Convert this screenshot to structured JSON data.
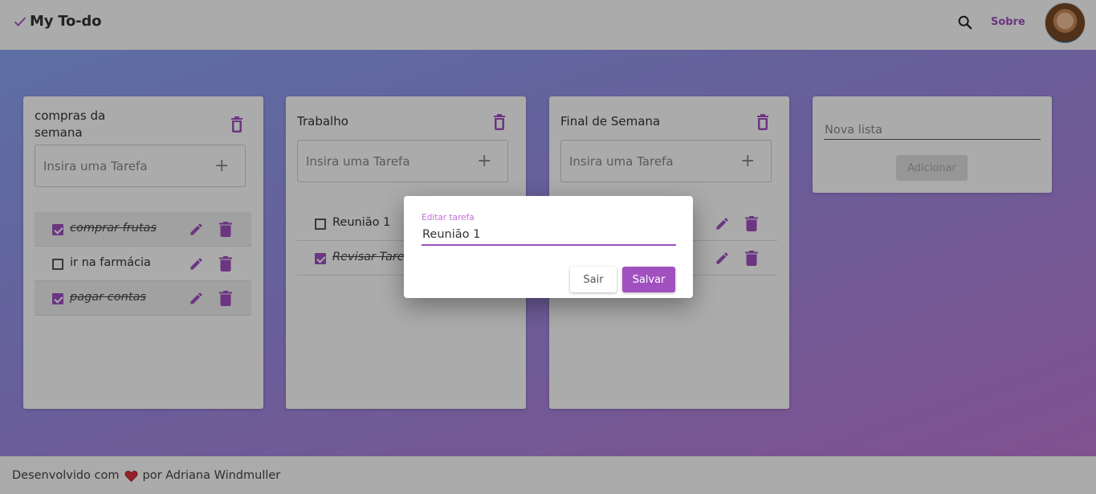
{
  "app": {
    "title": "My To-do"
  },
  "header": {
    "brand_icon": "check-icon",
    "search_icon": "search-icon",
    "about_label": "Sobre",
    "avatar": "user-avatar"
  },
  "colors": {
    "accent": "#a150c0",
    "accent_light": "#c070d8",
    "gradient_start": "#8aa6f5",
    "gradient_end": "#c07ad6"
  },
  "lists": [
    {
      "title": "compras da semana",
      "input_placeholder": "Insira uma Tarefa",
      "tasks": [
        {
          "label": "comprar frutas",
          "done": true
        },
        {
          "label": "ir na farmácia",
          "done": false
        },
        {
          "label": "pagar contas",
          "done": true
        }
      ]
    },
    {
      "title": "Trabalho",
      "input_placeholder": "Insira uma Tarefa",
      "tasks": [
        {
          "label": "Reunião 1",
          "done": false
        },
        {
          "label": "Revisar Tarefa",
          "done": true
        }
      ]
    },
    {
      "title": "Final de Semana",
      "input_placeholder": "Insira uma Tarefa",
      "tasks": []
    }
  ],
  "new_list": {
    "placeholder": "Nova lista",
    "add_label": "Adicionar"
  },
  "footer": {
    "text_before": "Desenvolvido com",
    "text_after": "por Adriana Windmuller",
    "heart_icon": "heart-icon"
  },
  "dialog": {
    "label": "Editar tarefa",
    "value": "Reunião 1",
    "cancel_label": "Sair",
    "save_label": "Salvar"
  }
}
